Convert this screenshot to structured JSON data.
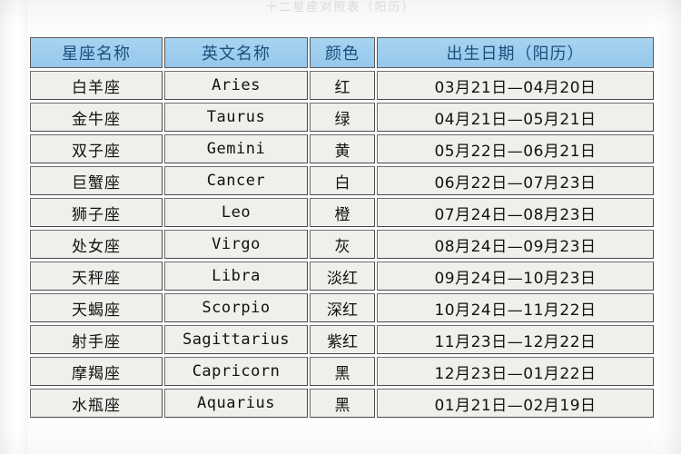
{
  "page": {
    "top_caption": "十二星座对照表（阳历）"
  },
  "table": {
    "columns": [
      {
        "key": "name",
        "label": "星座名称"
      },
      {
        "key": "en",
        "label": "英文名称"
      },
      {
        "key": "color",
        "label": "颜色"
      },
      {
        "key": "date",
        "label": "出生日期（阳历）"
      }
    ],
    "rows": [
      {
        "name": "白羊座",
        "en": "Aries",
        "color": "红",
        "date": "03月21日—04月20日"
      },
      {
        "name": "金牛座",
        "en": "Taurus",
        "color": "绿",
        "date": "04月21日—05月21日"
      },
      {
        "name": "双子座",
        "en": "Gemini",
        "color": "黄",
        "date": "05月22日—06月21日"
      },
      {
        "name": "巨蟹座",
        "en": "Cancer",
        "color": "白",
        "date": "06月22日—07月23日"
      },
      {
        "name": "狮子座",
        "en": "Leo",
        "color": "橙",
        "date": "07月24日—08月23日"
      },
      {
        "name": "处女座",
        "en": "Virgo",
        "color": "灰",
        "date": "08月24日—09月23日"
      },
      {
        "name": "天秤座",
        "en": "Libra",
        "color": "淡红",
        "date": "09月24日—10月23日"
      },
      {
        "name": "天蝎座",
        "en": "Scorpio",
        "color": "深红",
        "date": "10月24日—11月22日"
      },
      {
        "name": "射手座",
        "en": "Sagittarius",
        "color": "紫红",
        "date": "11月23日—12月22日"
      },
      {
        "name": "摩羯座",
        "en": "Capricorn",
        "color": "黑",
        "date": "12月23日—01月22日"
      },
      {
        "name": "水瓶座",
        "en": "Aquarius",
        "color": "黑",
        "date": "01月21日—02月19日"
      }
    ]
  },
  "colors": {
    "header_fill": "#9ecdee",
    "header_text": "#1d4f7c",
    "cell_fill": "#eef0ec",
    "cell_text": "#111111",
    "border": "#4a4a4a",
    "page_background": "#fdfdfd"
  }
}
